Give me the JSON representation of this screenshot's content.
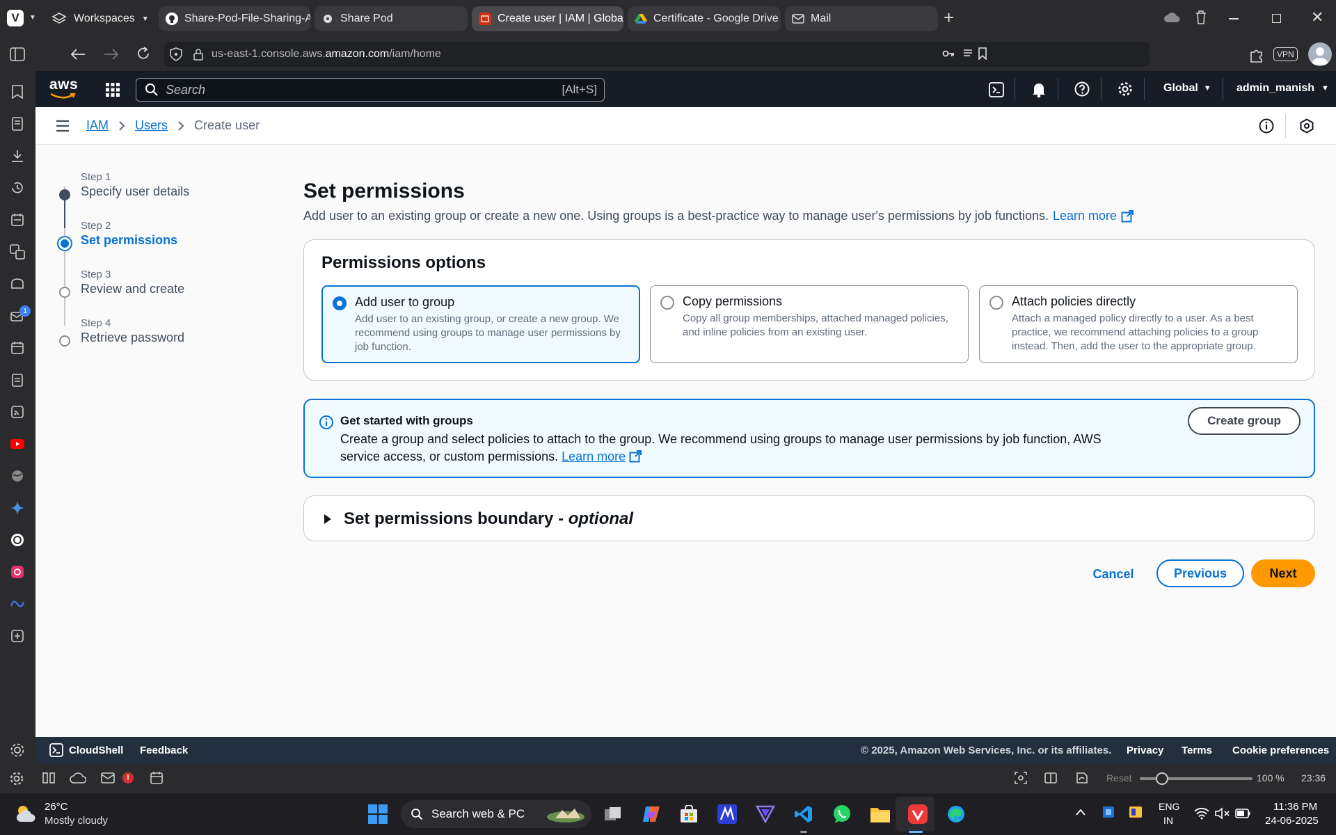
{
  "browser": {
    "workspaces_label": "Workspaces",
    "tabs": [
      {
        "title": "Share-Pod-File-Sharing-Ap"
      },
      {
        "title": "Share Pod"
      },
      {
        "title": "Create user | IAM | Global"
      },
      {
        "title": "Certificate - Google Drive"
      },
      {
        "title": "Mail"
      }
    ],
    "url_prefix": "us-east-1.console.aws.",
    "url_domain": "amazon.com",
    "url_path": "/iam/home",
    "vpn_label": "VPN",
    "sidebar_badge": "1"
  },
  "aws_header": {
    "logo": "aws",
    "search_placeholder": "Search",
    "search_shortcut": "[Alt+S]",
    "region": "Global",
    "user": "admin_manish"
  },
  "breadcrumb": {
    "items": [
      "IAM",
      "Users",
      "Create user"
    ]
  },
  "wizard_steps": [
    {
      "num": "Step 1",
      "title": "Specify user details",
      "state": "done"
    },
    {
      "num": "Step 2",
      "title": "Set permissions",
      "state": "current"
    },
    {
      "num": "Step 3",
      "title": "Review and create",
      "state": "pending"
    },
    {
      "num": "Step 4",
      "title": "Retrieve password",
      "state": "pending"
    }
  ],
  "main": {
    "title": "Set permissions",
    "description": "Add user to an existing group or create a new one. Using groups is a best-practice way to manage user's permissions by job functions.",
    "learn_more": "Learn more",
    "permissions_options": {
      "title": "Permissions options",
      "options": [
        {
          "title": "Add user to group",
          "desc": "Add user to an existing group, or create a new group. We recommend using groups to manage user permissions by job function.",
          "selected": true
        },
        {
          "title": "Copy permissions",
          "desc": "Copy all group memberships, attached managed policies, and inline policies from an existing user.",
          "selected": false
        },
        {
          "title": "Attach policies directly",
          "desc": "Attach a managed policy directly to a user. As a best practice, we recommend attaching policies to a group instead. Then, add the user to the appropriate group.",
          "selected": false
        }
      ]
    },
    "info_alert": {
      "title": "Get started with groups",
      "text": "Create a group and select policies to attach to the group. We recommend using groups to manage user permissions by job function, AWS service access, or custom permissions.",
      "learn_more": "Learn more",
      "button": "Create group"
    },
    "boundary": {
      "title": "Set permissions boundary - ",
      "optional": "optional"
    },
    "actions": {
      "cancel": "Cancel",
      "previous": "Previous",
      "next": "Next"
    }
  },
  "footer": {
    "cloudshell": "CloudShell",
    "feedback": "Feedback",
    "copyright": "© 2025, Amazon Web Services, Inc. or its affiliates.",
    "links": [
      "Privacy",
      "Terms",
      "Cookie preferences"
    ]
  },
  "statusbar": {
    "reset": "Reset",
    "zoom": "100 %",
    "zoom_level": 0.2,
    "time": "23:36"
  },
  "taskbar": {
    "weather_temp": "26°C",
    "weather_desc": "Mostly cloudy",
    "search": "Search web & PC",
    "lang1": "ENG",
    "lang2": "IN",
    "time": "11:36 PM",
    "date": "24-06-2025"
  },
  "colors": {
    "aws_nav": "#161d26",
    "link": "#0972d3",
    "primary_button": "#ff9900",
    "footer": "#232f3e"
  }
}
